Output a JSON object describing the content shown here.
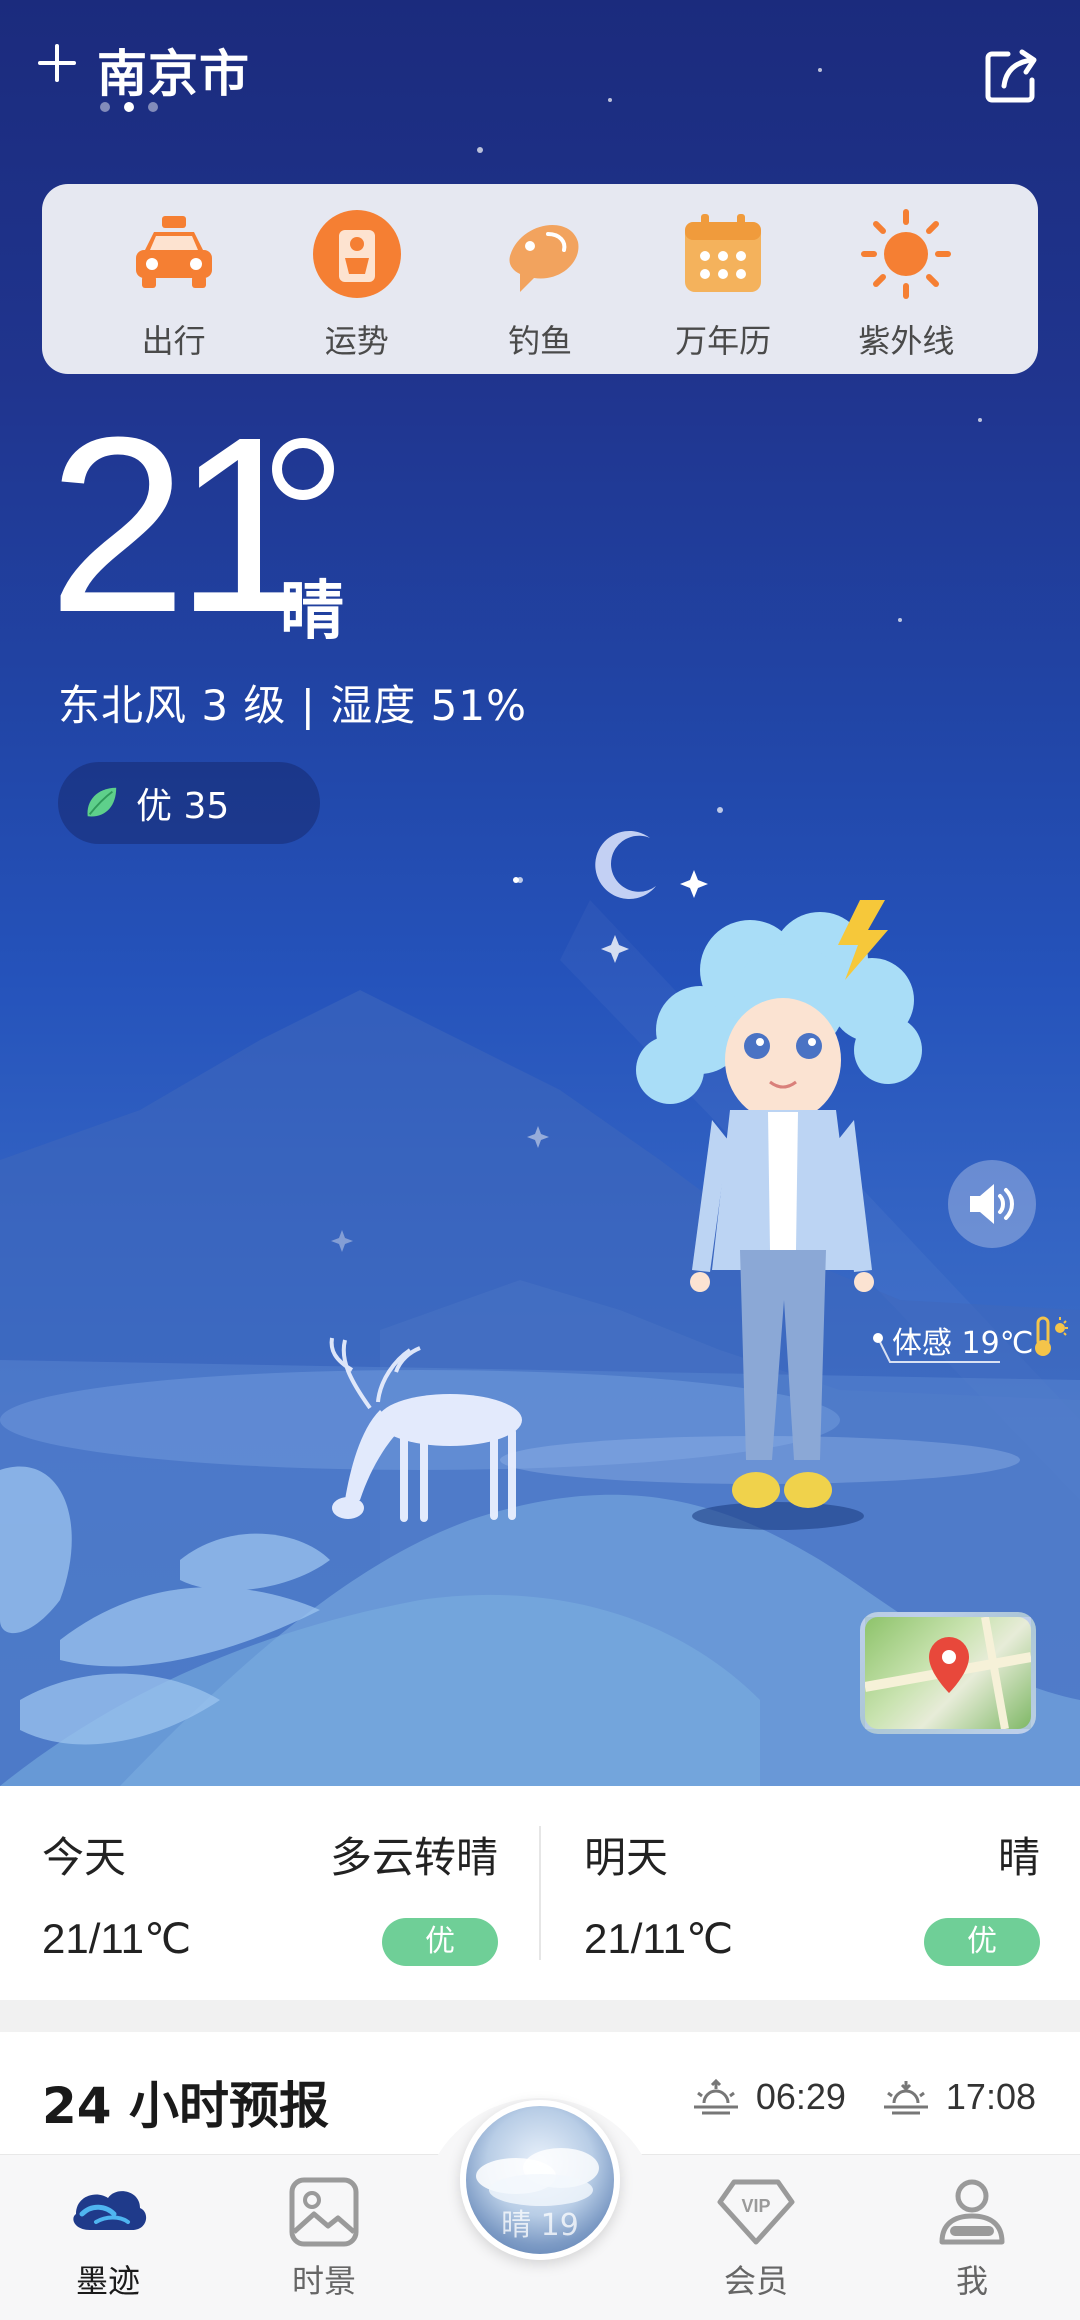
{
  "header": {
    "city": "南京市"
  },
  "quick_actions": [
    {
      "label": "出行",
      "icon": "taxi-icon"
    },
    {
      "label": "运势",
      "icon": "fortune-icon"
    },
    {
      "label": "钓鱼",
      "icon": "fish-icon"
    },
    {
      "label": "万年历",
      "icon": "calendar-icon"
    },
    {
      "label": "紫外线",
      "icon": "sun-icon"
    }
  ],
  "current": {
    "temperature": "21",
    "condition": "晴",
    "wind_humidity": "东北风 3 级 | 湿度 51%",
    "aqi": "优 35",
    "feels_like": "体感 19℃"
  },
  "days": [
    {
      "name": "今天",
      "condition": "多云转晴",
      "temp": "21/11℃",
      "aqi": "优"
    },
    {
      "name": "明天",
      "condition": "晴",
      "temp": "21/11℃",
      "aqi": "优"
    }
  ],
  "forecast": {
    "title": "24 小时预报",
    "sunrise": "06:29",
    "sunset": "17:08"
  },
  "nav": {
    "items": [
      {
        "label": "墨迹"
      },
      {
        "label": "时景"
      },
      {
        "label": "会员"
      },
      {
        "label": "我"
      }
    ],
    "center_text": "晴 19"
  },
  "colors": {
    "accent_orange": "#f57f33",
    "aqi_green": "#6fcf97",
    "sky_top": "#1b2b7d"
  }
}
